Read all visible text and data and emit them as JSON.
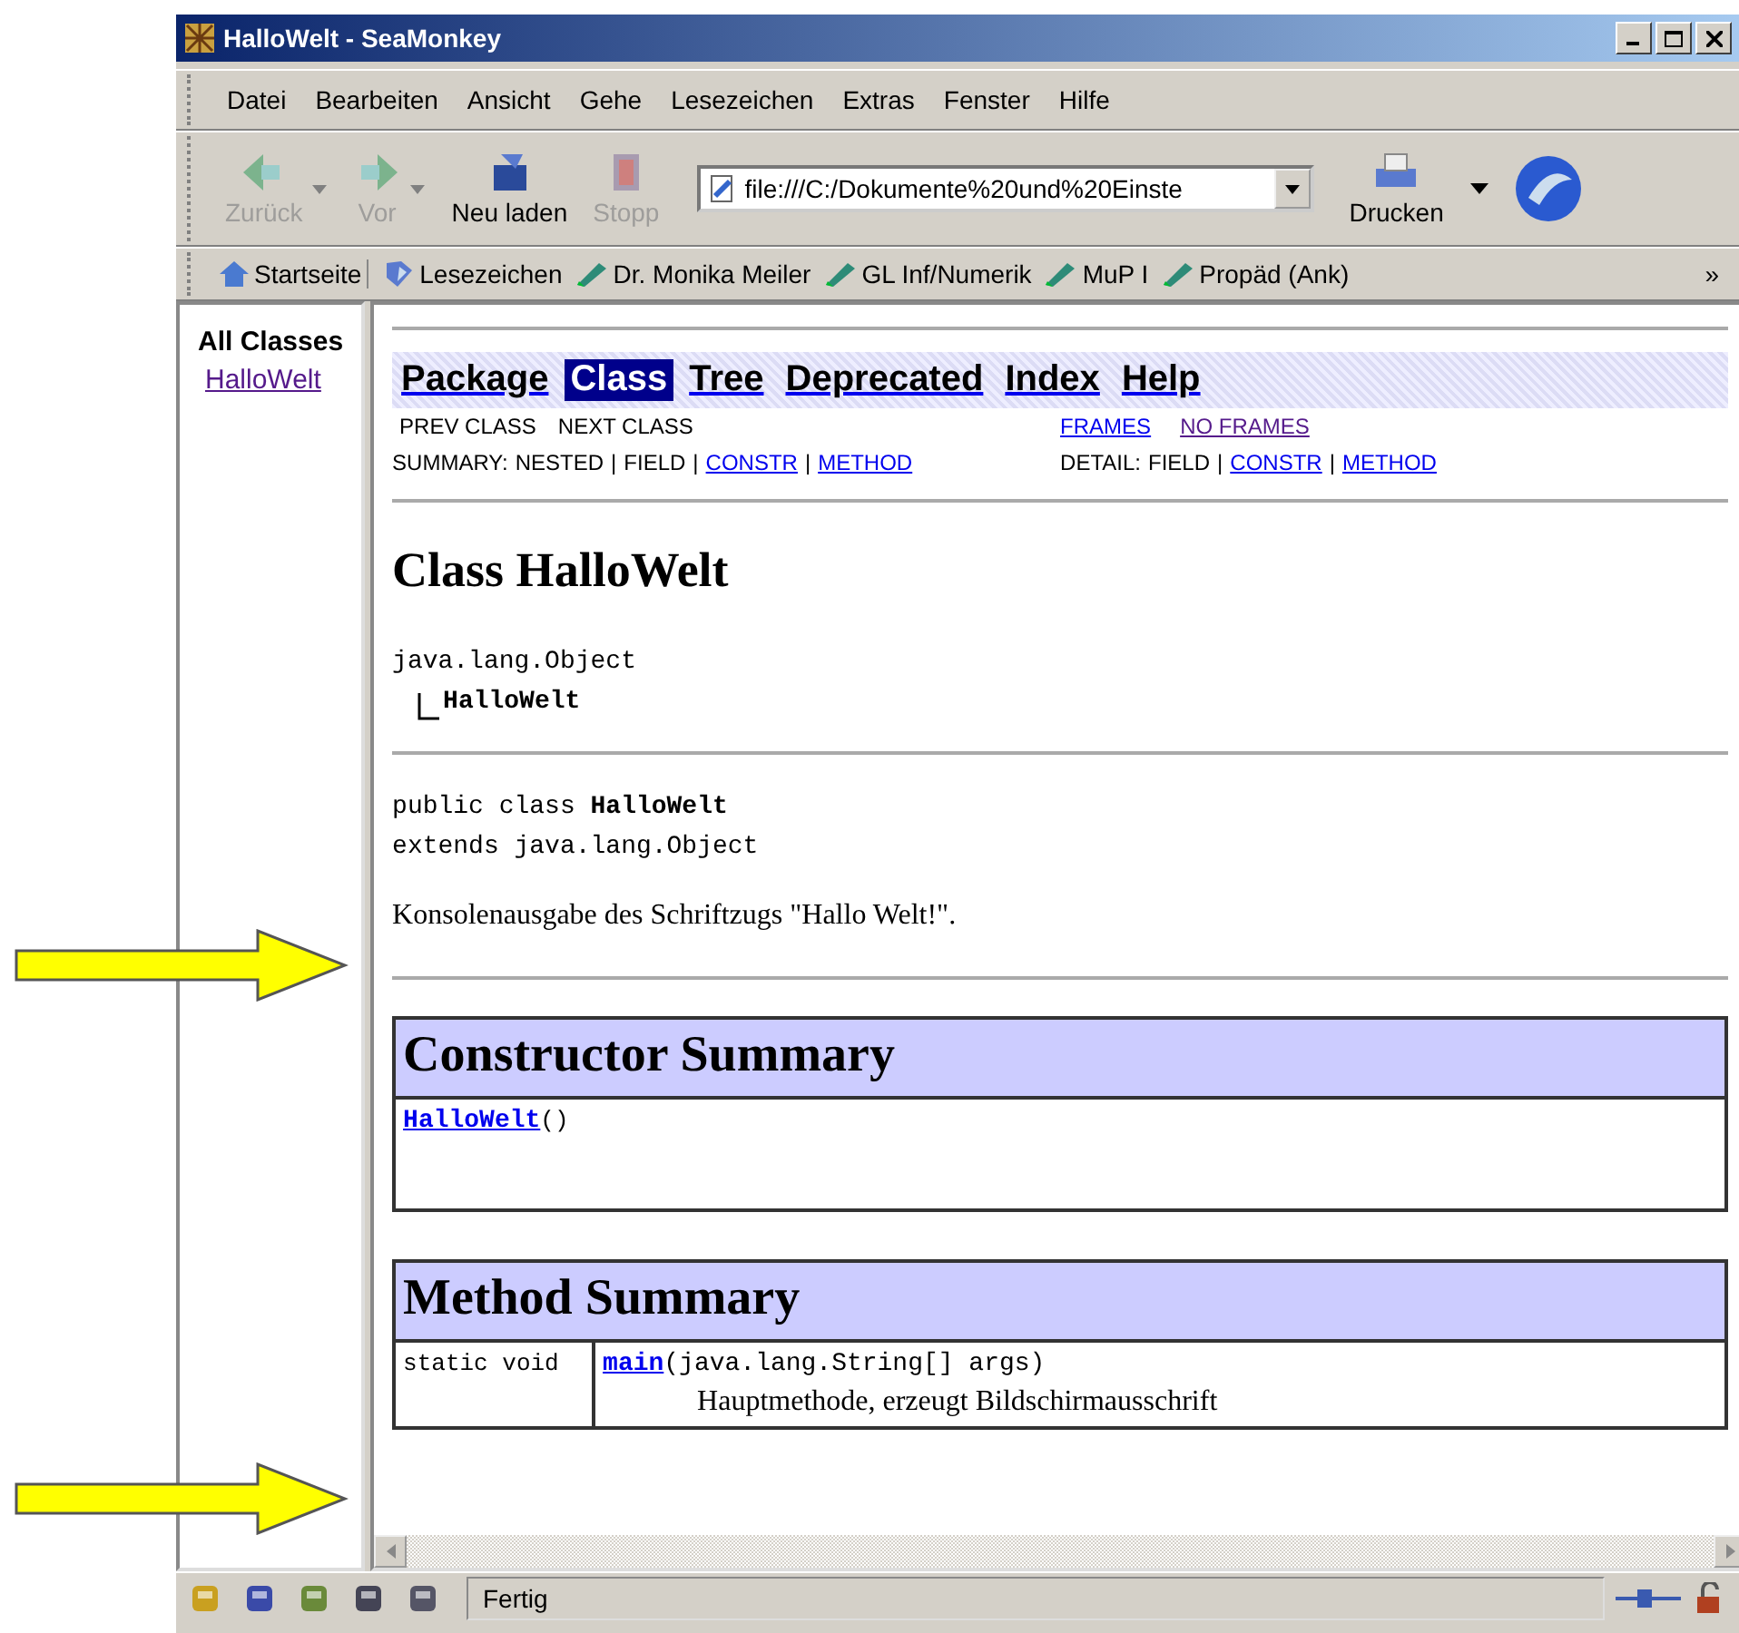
{
  "window": {
    "title": "HalloWelt - SeaMonkey"
  },
  "menu": [
    "Datei",
    "Bearbeiten",
    "Ansicht",
    "Gehe",
    "Lesezeichen",
    "Extras",
    "Fenster",
    "Hilfe"
  ],
  "toolbar": [
    {
      "kind": "back",
      "label": "Zurück",
      "disabled": true,
      "dropdown": true
    },
    {
      "kind": "forward",
      "label": "Vor",
      "disabled": true,
      "dropdown": true
    },
    {
      "kind": "reload",
      "label": "Neu laden",
      "disabled": false,
      "dropdown": false
    },
    {
      "kind": "stop",
      "label": "Stopp",
      "disabled": true,
      "dropdown": false
    }
  ],
  "url": "file:///C:/Dokumente%20und%20Einste",
  "print": {
    "label": "Drucken"
  },
  "bookmarks": [
    {
      "kind": "home",
      "label": "Startseite"
    },
    {
      "kind": "bookmarks",
      "label": "Lesezeichen"
    },
    {
      "kind": "link",
      "label": "Dr. Monika Meiler"
    },
    {
      "kind": "link",
      "label": "GL Inf/Numerik"
    },
    {
      "kind": "link",
      "label": "MuP I"
    },
    {
      "kind": "link",
      "label": "Propäd (Ank)"
    }
  ],
  "bookmarks_more": "»",
  "left_frame": {
    "heading": "All Classes",
    "classes": [
      {
        "label": "HalloWelt",
        "visited": true
      }
    ]
  },
  "navbar": [
    {
      "label": "Package",
      "selected": false
    },
    {
      "label": "Class",
      "selected": true
    },
    {
      "label": "Tree",
      "selected": false
    },
    {
      "label": "Deprecated",
      "selected": false
    },
    {
      "label": "Index",
      "selected": false
    },
    {
      "label": "Help",
      "selected": false
    }
  ],
  "subnav": {
    "prev": "PREV CLASS",
    "next": "NEXT CLASS",
    "frames": [
      {
        "label": "FRAMES",
        "visited": false
      },
      {
        "label": "NO FRAMES",
        "visited": true
      }
    ],
    "summary": {
      "label": "SUMMARY:",
      "separator": "|",
      "items": [
        {
          "label": "NESTED",
          "link": false
        },
        {
          "label": "FIELD",
          "link": false
        },
        {
          "label": "CONSTR",
          "link": true
        },
        {
          "label": "METHOD",
          "link": true
        }
      ]
    },
    "detail": {
      "label": "DETAIL:",
      "separator": "|",
      "items": [
        {
          "label": "FIELD",
          "link": false
        },
        {
          "label": "CONSTR",
          "link": true
        },
        {
          "label": "METHOD",
          "link": true
        }
      ]
    }
  },
  "class_title": "Class HalloWelt",
  "hierarchy": {
    "root": "java.lang.Object",
    "child": "HalloWelt"
  },
  "declaration": [
    "public class **HalloWelt**",
    "extends java.lang.Object"
  ],
  "description": "Konsolenausgabe des Schriftzugs \"Hallo Welt!\".",
  "constructor_summary": {
    "title": "Constructor Summary",
    "rows": [
      {
        "name": "HalloWelt",
        "params": "()"
      }
    ]
  },
  "method_summary": {
    "title": "Method Summary",
    "rows": [
      {
        "modifier": "static void",
        "name": "main",
        "params": "(java.lang.String[] args)",
        "description": "Hauptmethode, erzeugt Bildschirmausschrift"
      }
    ]
  },
  "status": {
    "text": "Fertig"
  }
}
